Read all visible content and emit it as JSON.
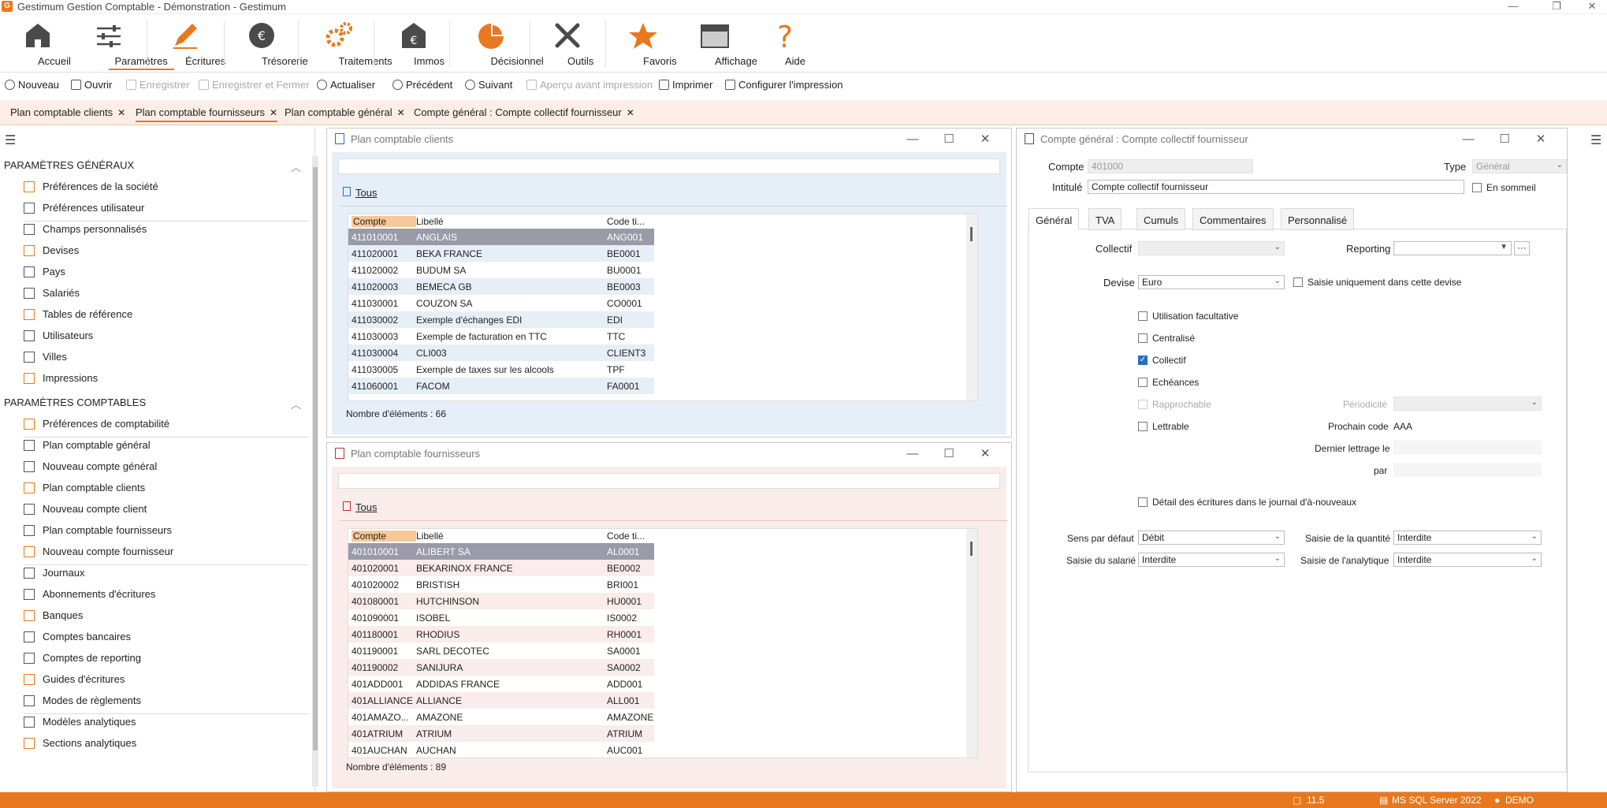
{
  "window": {
    "title": "Gestimum Gestion Comptable - Démonstration - Gestimum",
    "logo": "G"
  },
  "ribbon": [
    {
      "label": "Accueil",
      "icon": "home-icon"
    },
    {
      "label": "Paramètres",
      "icon": "settings-sliders-icon",
      "active": true
    },
    {
      "label": "Écritures",
      "icon": "pencil-icon"
    },
    {
      "label": "Trésorerie",
      "icon": "euro-coin-icon"
    },
    {
      "label": "Traitements",
      "icon": "gears-icon"
    },
    {
      "label": "Immos",
      "icon": "euro-house-icon"
    },
    {
      "label": "Décisionnel",
      "icon": "pie-chart-icon"
    },
    {
      "label": "Outils",
      "icon": "tools-icon"
    },
    {
      "label": "Favoris",
      "icon": "star-icon"
    },
    {
      "label": "Affichage",
      "icon": "window-icon"
    },
    {
      "label": "Aide",
      "icon": "question-icon"
    }
  ],
  "toolbar": {
    "nouveau": "Nouveau",
    "ouvrir": "Ouvrir",
    "enregistrer": "Enregistrer",
    "enregistrer_fermer": "Enregistrer et Fermer",
    "actualiser": "Actualiser",
    "precedent": "Précédent",
    "suivant": "Suivant",
    "apercu": "Aperçu avant impression",
    "imprimer": "Imprimer",
    "configurer": "Configurer l'impression"
  },
  "tabs": [
    "Plan comptable clients",
    "Plan comptable fournisseurs",
    "Plan comptable général",
    "Compte général : Compte collectif fournisseur"
  ],
  "nav": {
    "section1": "PARAMÈTRES GÉNÉRAUX",
    "section2": "PARAMÈTRES COMPTABLES",
    "items1": [
      "Préférences de la société",
      "Préférences utilisateur",
      "Champs personnalisés",
      "Devises",
      "Pays",
      "Salariés",
      "Tables de référence",
      "Utilisateurs",
      "Villes",
      "Impressions"
    ],
    "items2": [
      "Préférences de comptabilité",
      "Plan comptable général",
      "Nouveau compte général",
      "Plan comptable clients",
      "Nouveau compte client",
      "Plan comptable fournisseurs",
      "Nouveau compte fournisseur",
      "Journaux",
      "Abonnements d'écritures",
      "Banques",
      "Comptes bancaires",
      "Comptes de reporting",
      "Guides d'écritures",
      "Modes de règlements",
      "Modèles analytiques",
      "Sections analytiques"
    ]
  },
  "clients": {
    "title": "Plan comptable clients",
    "filter": "Tous",
    "headers": [
      "Compte",
      "Libellé",
      "Code ti..."
    ],
    "rows": [
      [
        "411010001",
        "ANGLAIS",
        "ANG001"
      ],
      [
        "411020001",
        "BEKA FRANCE",
        "BE0001"
      ],
      [
        "411020002",
        "BUDUM SA",
        "BU0001"
      ],
      [
        "411020003",
        "BEMECA GB",
        "BE0003"
      ],
      [
        "411030001",
        "COUZON SA",
        "CO0001"
      ],
      [
        "411030002",
        "Exemple d'échanges EDI",
        "EDI"
      ],
      [
        "411030003",
        "Exemple de facturation en TTC",
        "TTC"
      ],
      [
        "411030004",
        "CLI003",
        "CLIENT3"
      ],
      [
        "411030005",
        "Exemple de taxes sur les alcools",
        "TPF"
      ],
      [
        "411060001",
        "FACOM",
        "FA0001"
      ]
    ],
    "count": "Nombre d'éléments : 66"
  },
  "fournisseurs": {
    "title": "Plan comptable fournisseurs",
    "filter": "Tous",
    "headers": [
      "Compte",
      "Libellé",
      "Code ti..."
    ],
    "rows": [
      [
        "401010001",
        "ALIBERT SA",
        "AL0001"
      ],
      [
        "401020001",
        "BEKARINOX FRANCE",
        "BE0002"
      ],
      [
        "401020002",
        "BRISTISH",
        "BRI001"
      ],
      [
        "401080001",
        "HUTCHINSON",
        "HU0001"
      ],
      [
        "401090001",
        "ISOBEL",
        "IS0002"
      ],
      [
        "401180001",
        "RHODIUS",
        "RH0001"
      ],
      [
        "401190001",
        "SARL DECOTEC",
        "SA0001"
      ],
      [
        "401190002",
        "SANIJURA",
        "SA0002"
      ],
      [
        "401ADD001",
        "ADDIDAS FRANCE",
        "ADD001"
      ],
      [
        "401ALLIANCE",
        "ALLIANCE",
        "ALL001"
      ],
      [
        "401AMAZO...",
        "AMAZONE",
        "AMAZONE"
      ],
      [
        "401ATRIUM",
        "ATRIUM",
        "ATRIUM"
      ],
      [
        "401AUCHAN",
        "AUCHAN",
        "AUC001"
      ]
    ],
    "count": "Nombre d'éléments : 89"
  },
  "compte": {
    "title": "Compte général : Compte collectif fournisseur",
    "compte_label": "Compte",
    "compte_value": "401000",
    "type_label": "Type",
    "type_value": "Général",
    "intitule_label": "Intitulé",
    "intitule_value": "Compte collectif fournisseur",
    "en_sommeil": "En sommeil",
    "tabs": [
      "Général",
      "TVA",
      "Cumuls",
      "Commentaires",
      "Personnalisé"
    ],
    "collectif_label": "Collectif",
    "reporting_label": "Reporting",
    "devise_label": "Devise",
    "devise_value": "Euro",
    "saisie_devise": "Saisie uniquement dans cette devise",
    "utilisation": "Utilisation facultative",
    "centralise": "Centralisé",
    "collectif": "Collectif",
    "echeances": "Echéances",
    "rapprochable": "Rapprochable",
    "lettrable": "Lettrable",
    "periodicite_label": "Périodicité",
    "prochain_label": "Prochain code",
    "prochain_value": "AAA",
    "dernier_label": "Dernier lettrage le",
    "par_label": "par",
    "detail": "Détail des écritures dans le journal d'à-nouveaux",
    "sens_label": "Sens par défaut",
    "sens_value": "Débit",
    "quantite_label": "Saisie de la quantité",
    "quantite_value": "Interdite",
    "salarie_label": "Saisie du salarié",
    "salarie_value": "Interdite",
    "analytique_label": "Saisie de l'analytique",
    "analytique_value": "Interdite"
  },
  "status": {
    "version": "11.5",
    "server": "MS SQL Server 2022",
    "user": "DEMO"
  },
  "colors": {
    "accent": "#e8781e",
    "selection": "#9a9aa8"
  }
}
